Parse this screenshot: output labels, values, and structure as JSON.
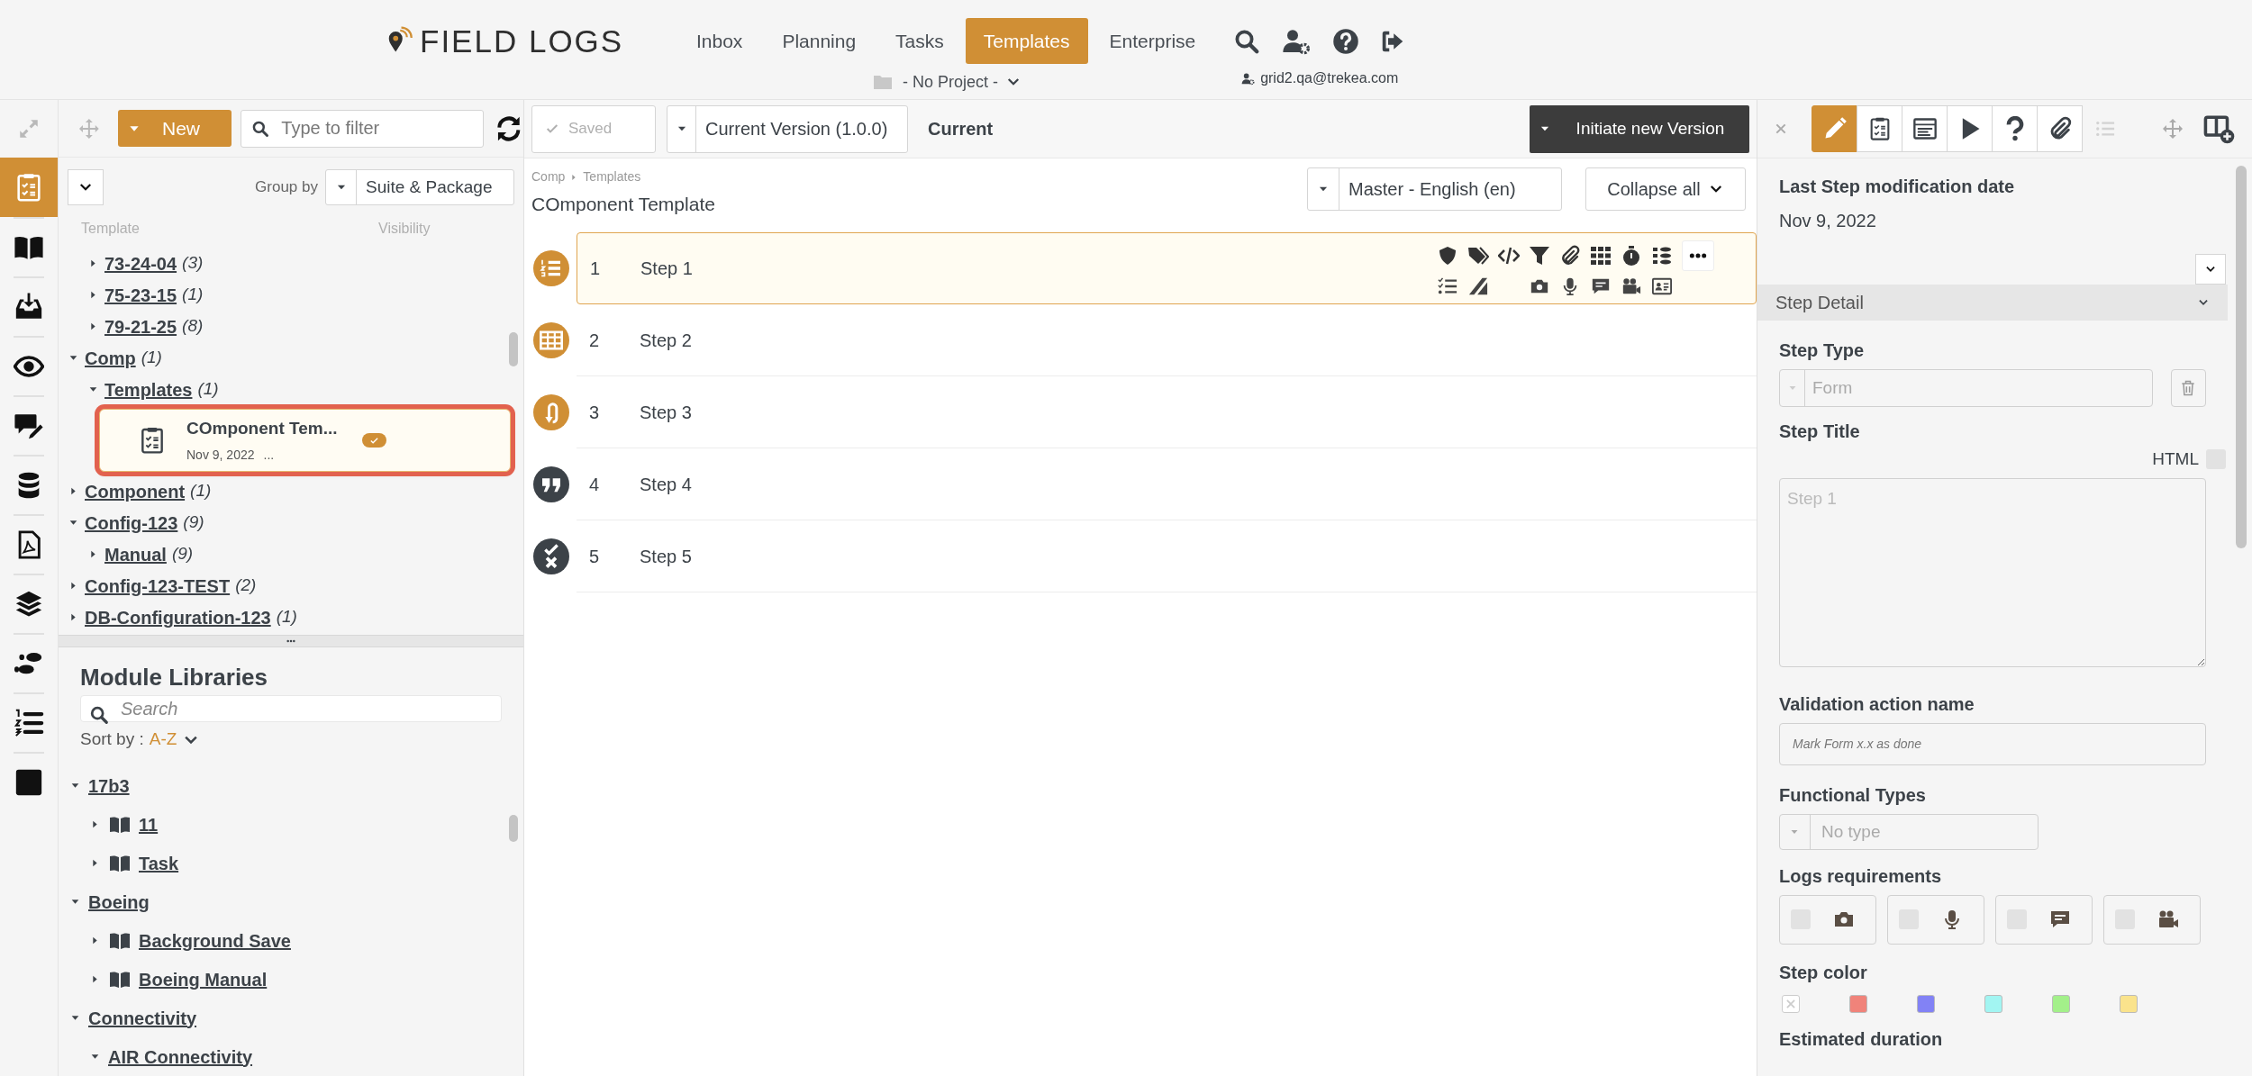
{
  "header": {
    "logo": "FIELD LOGS",
    "nav": [
      {
        "label": "Inbox",
        "selected": false
      },
      {
        "label": "Planning",
        "selected": false
      },
      {
        "label": "Tasks",
        "selected": false
      },
      {
        "label": "Templates",
        "selected": true
      },
      {
        "label": "Enterprise",
        "selected": false
      }
    ],
    "project": "- No Project -",
    "user": "grid2.qa@trekea.com"
  },
  "rail": [
    {
      "kind": "clipboard",
      "selected": true
    },
    {
      "kind": "book",
      "selected": false
    },
    {
      "kind": "inbox",
      "selected": false
    },
    {
      "kind": "eye",
      "selected": false
    },
    {
      "kind": "chat",
      "selected": false
    },
    {
      "kind": "database",
      "selected": false
    },
    {
      "kind": "pdf",
      "selected": false
    },
    {
      "kind": "layers",
      "selected": false
    },
    {
      "kind": "footprints",
      "selected": false
    },
    {
      "kind": "numlist",
      "selected": false
    },
    {
      "kind": "square",
      "selected": false
    }
  ],
  "templates_panel": {
    "new_button": "New",
    "filter_placeholder": "Type to filter",
    "group_by_label": "Group by",
    "group_by_value": "Suite & Package",
    "columns": [
      "Template",
      "Visibility"
    ],
    "tree": [
      {
        "kind": "group",
        "children": [
          {
            "kind": "folder",
            "label": "73-24-04",
            "count": "(3)",
            "expanded": false
          },
          {
            "kind": "folder",
            "label": "75-23-15",
            "count": "(1)",
            "expanded": false
          },
          {
            "kind": "folder",
            "label": "79-21-25",
            "count": "(8)",
            "expanded": false
          }
        ]
      },
      {
        "kind": "folder",
        "label": "Comp",
        "count": "(1)",
        "expanded": true,
        "children": [
          {
            "kind": "folder",
            "label": "Templates",
            "count": "(1)",
            "expanded": true,
            "children": [
              {
                "kind": "template",
                "label": "COmponent Tem...",
                "date": "Nov 9, 2022",
                "more": "...",
                "visible": true,
                "selected": true
              }
            ]
          }
        ]
      },
      {
        "kind": "folder",
        "label": "Component",
        "count": "(1)",
        "expanded": false
      },
      {
        "kind": "folder",
        "label": "Config-123",
        "count": "(9)",
        "expanded": true,
        "children": [
          {
            "kind": "folder",
            "label": "Manual",
            "count": "(9)",
            "expanded": false
          }
        ]
      },
      {
        "kind": "folder",
        "label": "Config-123-TEST",
        "count": "(2)",
        "expanded": false
      },
      {
        "kind": "folder",
        "label": "DB-Configuration-123",
        "count": "(1)",
        "expanded": false
      }
    ]
  },
  "module_libraries": {
    "title": "Module Libraries",
    "search_placeholder": "Search",
    "sort_label": "Sort by :",
    "sort_value": "A-Z",
    "tree": [
      {
        "kind": "folder",
        "label": "17b3",
        "expanded": true,
        "children": [
          {
            "kind": "library",
            "label": "11",
            "expanded": false
          },
          {
            "kind": "library",
            "label": "Task",
            "expanded": false
          }
        ]
      },
      {
        "kind": "folder",
        "label": "Boeing",
        "expanded": true,
        "children": [
          {
            "kind": "library",
            "label": "Background Save",
            "expanded": false
          },
          {
            "kind": "library",
            "label": "Boeing Manual",
            "expanded": false
          }
        ]
      },
      {
        "kind": "folder",
        "label": "Connectivity",
        "expanded": true,
        "children": [
          {
            "kind": "folder",
            "label": "AIR Connectivity",
            "expanded": true
          }
        ]
      }
    ]
  },
  "editor": {
    "saved": "Saved",
    "version": "Current Version (1.0.0)",
    "status": "Current",
    "initiate": "Initiate new Version",
    "breadcrumb": [
      "Comp",
      "Templates"
    ],
    "title": "COmponent Template",
    "language": "Master - English (en)",
    "collapse": "Collapse all",
    "steps": [
      {
        "number": "1",
        "title": "Step 1",
        "kind": "list",
        "selected": true
      },
      {
        "number": "2",
        "title": "Step 2",
        "kind": "table",
        "selected": false
      },
      {
        "number": "3",
        "title": "Step 3",
        "kind": "loop",
        "selected": false
      },
      {
        "number": "4",
        "title": "Step 4",
        "kind": "quote",
        "selected": false
      },
      {
        "number": "5",
        "title": "Step 5",
        "kind": "checkx",
        "selected": false
      }
    ]
  },
  "details": {
    "tabs": [
      {
        "kind": "pencil",
        "selected": true,
        "disabled": false
      },
      {
        "kind": "clipboard",
        "selected": false,
        "disabled": false
      },
      {
        "kind": "form",
        "selected": false,
        "disabled": false
      },
      {
        "kind": "play",
        "selected": false,
        "disabled": false
      },
      {
        "kind": "question",
        "selected": false,
        "disabled": false
      },
      {
        "kind": "clip",
        "selected": false,
        "disabled": false
      },
      {
        "kind": "list",
        "selected": false,
        "disabled": true
      }
    ],
    "modified_label": "Last Step modification date",
    "modified_value": "Nov 9, 2022",
    "section": "Step Detail",
    "step_type_label": "Step Type",
    "step_type_value": "Form",
    "step_title_label": "Step Title",
    "html_label": "HTML",
    "html_checked": false,
    "step_title_placeholder": "Step 1",
    "validation_label": "Validation action name",
    "validation_placeholder": "Mark Form x.x as done",
    "functional_label": "Functional Types",
    "functional_placeholder": "No type",
    "logs_label": "Logs requirements",
    "logs": [
      {
        "kind": "camera",
        "checked": false
      },
      {
        "kind": "mic",
        "checked": false
      },
      {
        "kind": "comment",
        "checked": false
      },
      {
        "kind": "video",
        "checked": false
      }
    ],
    "color_label": "Step color",
    "colors": [
      {
        "kind": "none"
      },
      {
        "kind": "swatch",
        "color": "#f0837a"
      },
      {
        "kind": "swatch",
        "color": "#8282f5"
      },
      {
        "kind": "swatch",
        "color": "#a2f5f2"
      },
      {
        "kind": "swatch",
        "color": "#a3f08a"
      },
      {
        "kind": "swatch",
        "color": "#fae38c"
      }
    ],
    "duration_label": "Estimated duration"
  }
}
